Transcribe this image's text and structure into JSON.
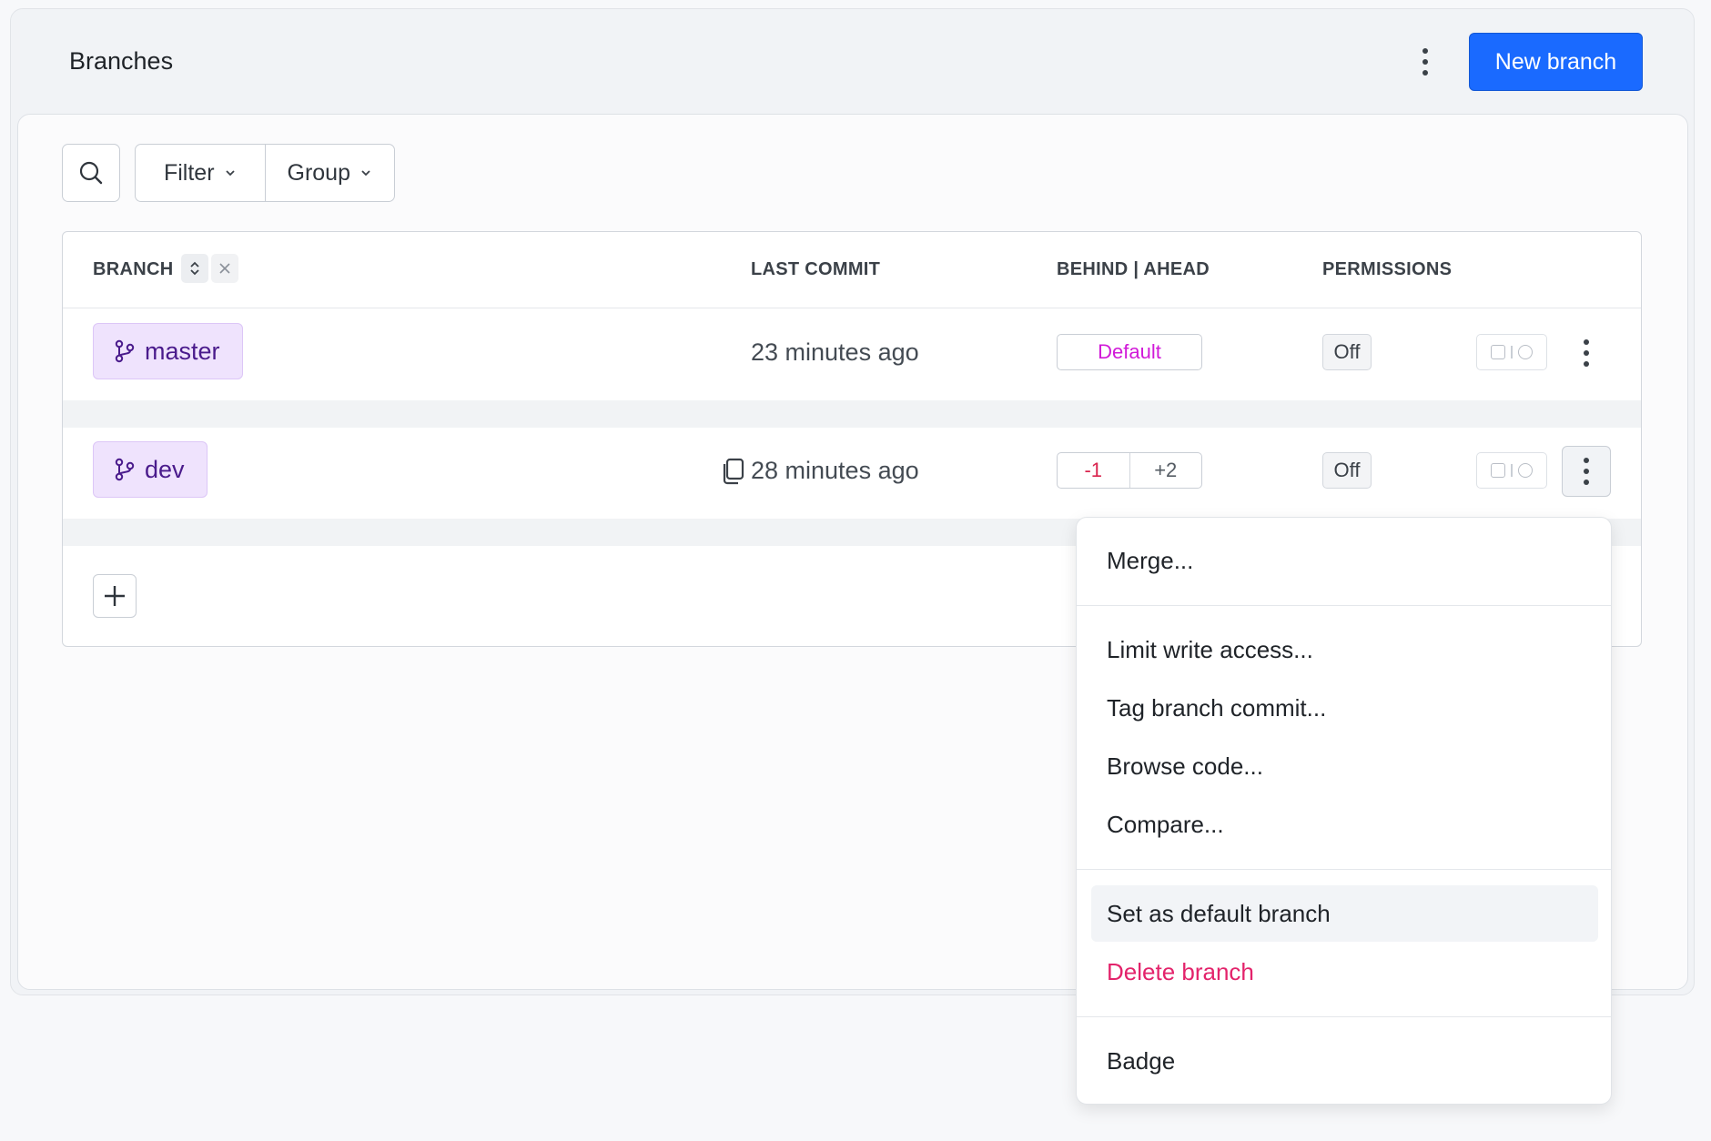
{
  "header": {
    "title": "Branches",
    "new_branch_label": "New branch"
  },
  "toolbar": {
    "filter_label": "Filter",
    "group_label": "Group"
  },
  "table": {
    "columns": {
      "branch": "BRANCH",
      "last_commit": "LAST COMMIT",
      "behind_ahead": "BEHIND | AHEAD",
      "permissions": "PERMISSIONS"
    },
    "rows": [
      {
        "name": "master",
        "last_commit": "23 minutes ago",
        "status": "Default",
        "permissions": "Off"
      },
      {
        "name": "dev",
        "last_commit": "28 minutes ago",
        "behind": "-1",
        "ahead": "+2",
        "permissions": "Off"
      }
    ]
  },
  "context_menu": {
    "items": [
      "Merge...",
      "Limit write access...",
      "Tag branch commit...",
      "Browse code...",
      "Compare...",
      "Set as default branch",
      "Delete branch",
      "Badge"
    ]
  },
  "colors": {
    "primary": "#1a6aff",
    "branch_chip_bg": "#efe3fd",
    "branch_chip_text": "#4a1b8c",
    "default_badge": "#d11ad8",
    "behind": "#d9244e",
    "danger": "#e3236b"
  }
}
